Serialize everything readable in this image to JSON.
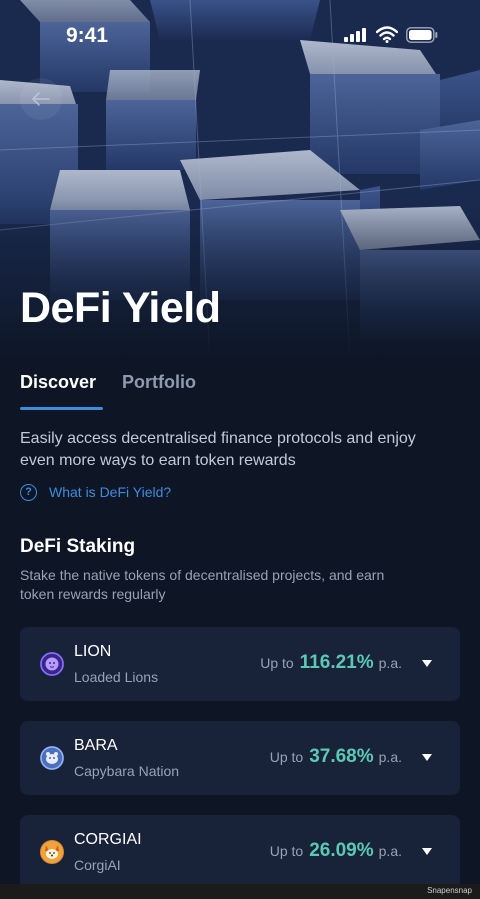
{
  "status_bar": {
    "time": "9:41"
  },
  "header": {
    "title": "DeFi Yield"
  },
  "tabs": [
    {
      "label": "Discover",
      "active": true
    },
    {
      "label": "Portfolio",
      "active": false
    }
  ],
  "intro": {
    "text": "Easily access decentralised finance protocols and enjoy even more ways to earn token rewards",
    "help_link": "What is DeFi Yield?"
  },
  "staking": {
    "title": "DeFi Staking",
    "description": "Stake the native tokens of decentralised projects, and earn token rewards regularly",
    "items": [
      {
        "symbol": "LION",
        "name": "Loaded Lions",
        "rate_prefix": "Up to",
        "rate": "116.21%",
        "rate_suffix": "p.a.",
        "icon": "lion-token-icon"
      },
      {
        "symbol": "BARA",
        "name": "Capybara Nation",
        "rate_prefix": "Up to",
        "rate": "37.68%",
        "rate_suffix": "p.a.",
        "icon": "bara-token-icon"
      },
      {
        "symbol": "CORGIAI",
        "name": "CorgiAI",
        "rate_prefix": "Up to",
        "rate": "26.09%",
        "rate_suffix": "p.a.",
        "icon": "corgiai-token-icon"
      }
    ]
  },
  "watermark": "Snapensnap",
  "colors": {
    "accent": "#3f8bdc",
    "rate": "#5cc9b4",
    "background": "#0e1626",
    "card": "#18233a"
  }
}
